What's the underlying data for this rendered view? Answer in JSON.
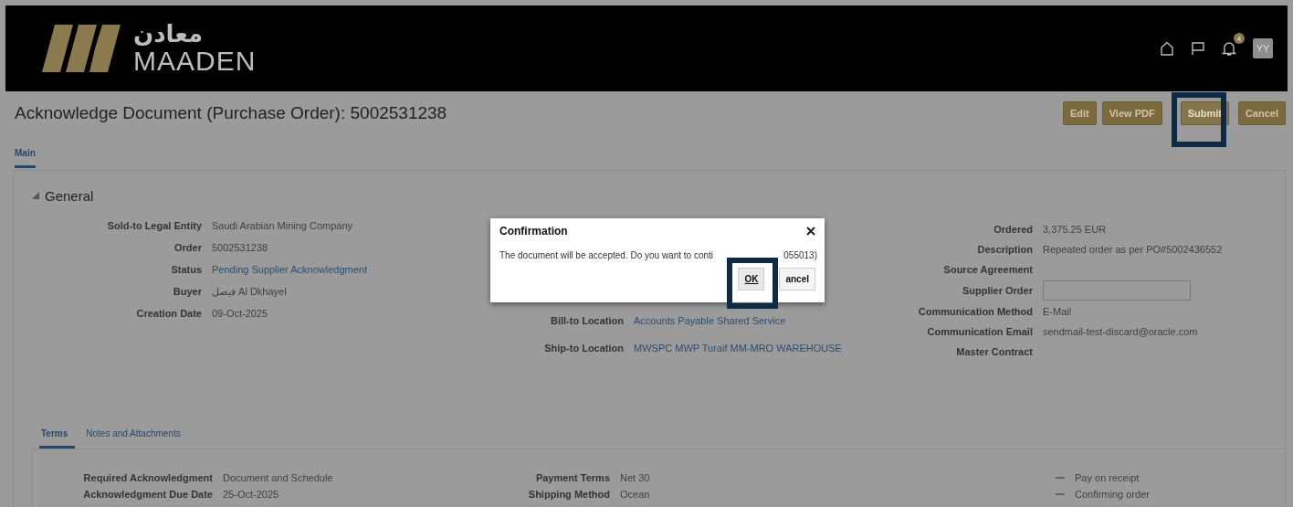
{
  "header": {
    "logo_arabic": "معادن",
    "logo_latin": "MAADEN",
    "notification_count": "4",
    "avatar": "YY"
  },
  "page_title": "Acknowledge Document (Purchase Order): 5002531238",
  "actions": [
    {
      "label": "Edit",
      "highlighted": false
    },
    {
      "label": "View PDF",
      "highlighted": false
    },
    {
      "label": "Submit",
      "highlighted": true
    },
    {
      "label": "Cancel",
      "highlighted": false
    }
  ],
  "tabs": [
    {
      "label": "Main",
      "selected": true
    }
  ],
  "section": {
    "title": "General",
    "expanded": true
  },
  "columns": [
    [
      {
        "label": "Sold-to Legal Entity",
        "value": "Saudi Arabian Mining Company",
        "kind": "text"
      },
      {
        "label": "Order",
        "value": "5002531238",
        "kind": "text"
      },
      {
        "label": "Status",
        "value": "Pending Supplier Acknowledgment",
        "kind": "link"
      },
      {
        "label": "Buyer",
        "value": "فيصل Al Dkhayel",
        "kind": "text"
      },
      {
        "label": "Creation Date",
        "value": "09-Oct-2025",
        "kind": "text"
      }
    ],
    [
      {
        "label": "Bill-to Location",
        "value": "Accounts Payable Shared Service",
        "kind": "link"
      },
      {
        "label": "Ship-to Location",
        "value": "MWSPC MWP Turaif MM-MRO WAREHOUSE",
        "kind": "link"
      }
    ],
    [
      {
        "label": "Ordered",
        "value": "3,375.25 EUR",
        "kind": "text"
      },
      {
        "label": "Description",
        "value": "Repeated order as per PO#5002436552",
        "kind": "text"
      },
      {
        "label": "Source Agreement",
        "kind": "text"
      },
      {
        "label": "Supplier Order",
        "kind": "input"
      },
      {
        "label": "Communication Method",
        "value": "E-Mail",
        "kind": "text"
      },
      {
        "label": "Communication Email",
        "value": "sendmail-test-discard@oracle.com",
        "kind": "text"
      },
      {
        "label": "Master Contract",
        "kind": "text"
      }
    ]
  ],
  "subtabs": [
    {
      "label": "Terms",
      "selected": true
    },
    {
      "label": "Notes and Attachments",
      "selected": false
    }
  ],
  "terms_columns": [
    [
      {
        "label": "Required Acknowledgment",
        "value": "Document and Schedule"
      },
      {
        "label": "Acknowledgment Due Date",
        "value": "25-Oct-2025"
      }
    ],
    [
      {
        "label": "Payment Terms",
        "value": "Net 30"
      },
      {
        "label": "Shipping Method",
        "value": "Ocean"
      }
    ]
  ],
  "terms_flags": [
    {
      "label": "Pay on receipt",
      "checked": false
    },
    {
      "label": "Confirming order",
      "checked": false
    }
  ],
  "dialog": {
    "title": "Confirmation",
    "message": "The document will be accepted. Do you want to conti",
    "message_tail": "055013)",
    "buttons": [
      {
        "label": "OK",
        "highlighted": true
      },
      {
        "label": "ancel",
        "highlighted": false
      }
    ]
  }
}
